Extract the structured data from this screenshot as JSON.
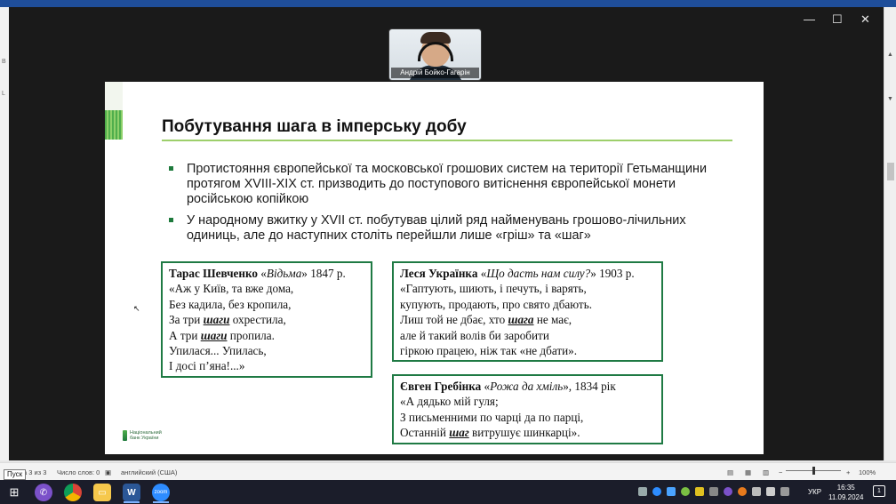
{
  "participant": {
    "name": "Андрій Бойко-Гагарін"
  },
  "word_left_letters": [
    "В",
    "L"
  ],
  "slide": {
    "title": "Побутування шага в імперську добу",
    "bullets": [
      "Протистояння європейської та московської грошових систем на території Гетьманщини протягом XVIII-XIX ст. призводить до поступового витіснення європейської монети російською копійкою",
      "У народному вжитку у XVII ст. побутував цілий ряд найменувань грошово-лічильних одиниць, але до наступних століть перейшли лише «гріш» та «шаг»"
    ],
    "quotes": {
      "shevchenko": {
        "author": "Тарас Шевченко",
        "open": " «",
        "work": "Відьма",
        "close": "» 1847 р.",
        "l1": "«Аж у Київ, та вже дома,",
        "l2": "Без кадила, без кропила,",
        "l3a": "За три ",
        "l3b": "шаги",
        "l3c": " охрестила,",
        "l4a": "А три ",
        "l4b": "шаги",
        "l4c": " пропила.",
        "l5": "Упилася... Упилась,",
        "l6": "І досі п’яна!...»"
      },
      "ukrainka": {
        "author": "Леся Українка",
        "open": " «",
        "work": "Що дасть нам силу?",
        "close": "» 1903 р.",
        "l1": "«Гаптують, шиють, і печуть, і варять,",
        "l2": "купують, продають, про свято дбають.",
        "l3a": "Лиш той не дбає, хто ",
        "l3b": "шага",
        "l3c": " не має,",
        "l4": "але й такий волів би заробити",
        "l5": "гіркою працею, ніж так «не дбати»."
      },
      "hrebinka": {
        "author": "Євген Гребінка",
        "open": " «",
        "work": "Рожа да хміль",
        "close": "», 1834 рік",
        "l1": "«А дядько мій гуля;",
        "l2": "З письменними по чарці да по парці,",
        "l3a": "Останній ",
        "l3b": "шаг",
        "l3c": " витрушує шинкарці»."
      }
    },
    "logo": {
      "line1": "Національний",
      "line2": "банк України"
    }
  },
  "word_status": {
    "page": "а 3 из 3",
    "words": "Число слов: 0",
    "language": "английский (США)",
    "zoom": "100%"
  },
  "tooltip": "Пуск",
  "taskbar": {
    "language": "УКР",
    "time": "16:35",
    "date": "11.09.2024",
    "notifications": "1"
  }
}
